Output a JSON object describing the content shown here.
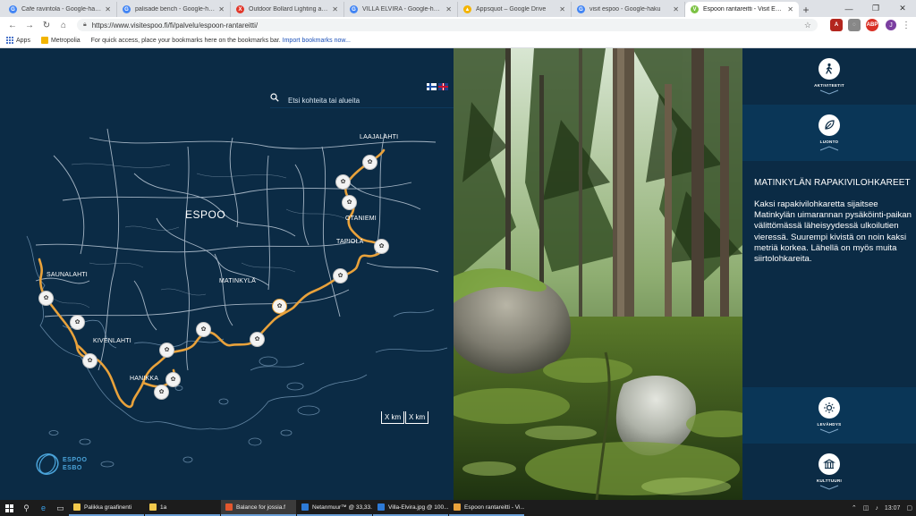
{
  "browser": {
    "tabs": [
      {
        "title": "Cafe ravintola - Google-haku",
        "color": "#4285f4",
        "glyph": "G",
        "active": false
      },
      {
        "title": "palisade bench - Google-haku",
        "color": "#4285f4",
        "glyph": "G",
        "active": false
      },
      {
        "title": "Outdoor Bollard Lighting and sp",
        "color": "#e2372a",
        "glyph": "X",
        "active": false
      },
      {
        "title": "VILLA ELVIRA - Google-haku",
        "color": "#4285f4",
        "glyph": "G",
        "active": false
      },
      {
        "title": "Appsquot – Google Drive",
        "color": "#f4b400",
        "glyph": "▲",
        "active": false
      },
      {
        "title": "visit espoo - Google-haku",
        "color": "#4285f4",
        "glyph": "G",
        "active": false
      },
      {
        "title": "Espoon rantareitti - Visit Espoo",
        "color": "#7cc243",
        "glyph": "V",
        "active": true
      }
    ],
    "url": "https://www.visitespoo.fi/fi/palvelu/espoon-rantareitti/",
    "bookmarks": {
      "apps": "Apps",
      "metropolia": "Metropolia",
      "hint_text": "For quick access, place your bookmarks here on the bookmarks bar.",
      "hint_link": "Import bookmarks now..."
    }
  },
  "map": {
    "search_placeholder": "Etsi kohteita tai alueita",
    "city_label": "ESPOO",
    "places": {
      "laajalahti": "LAAJALAHTI",
      "otaniemi": "OTANIEMI",
      "tapiola": "TAPIOLA",
      "matinkyla": "MATINKYLÄ",
      "saunalahti": "SAUNALAHTI",
      "kivenlahti": "KIVENLAHTI",
      "hanikka": "HANIKKA"
    },
    "scale_left": "X km",
    "scale_right": "X km",
    "logo_line1": "ESPOO",
    "logo_line2": "ESBO",
    "route_color": "#e9a23b"
  },
  "panel": {
    "sections": {
      "activities": "AKTIVITEETIT",
      "nature": "LUONTO",
      "rest": "LEVÄHDYS",
      "culture": "KULTTUURI"
    },
    "title": "MATINKYLÄN RAPAKIVILOHKAREET",
    "text": "Kaksi rapakivilohkaretta sijaitsee Matinkylän uimarannan pysäköinti-paikan välittömässä läheisyydessä ulkoilutien vieressä. Suurempi kivistä on noin kaksi metriä korkea. Lähellä on myös muita siirtolohkareita."
  },
  "taskbar": {
    "items": [
      {
        "label": "Palikka graafinenti",
        "color": "#f2c94c",
        "active": false
      },
      {
        "label": "1a",
        "color": "#f2c94c",
        "active": false
      },
      {
        "label": "Balance for jossia.f",
        "color": "#e4572e",
        "active": true
      },
      {
        "label": "Netanmuur™ @ 33,33...",
        "color": "#2d7ad6",
        "active": false
      },
      {
        "label": "Villa-Elvira.jpg @ 100...",
        "color": "#2d7ad6",
        "active": false
      },
      {
        "label": "Espoon rantareitti - Vi...",
        "color": "#e9a23b",
        "active": false
      }
    ],
    "clock": "13:07"
  }
}
